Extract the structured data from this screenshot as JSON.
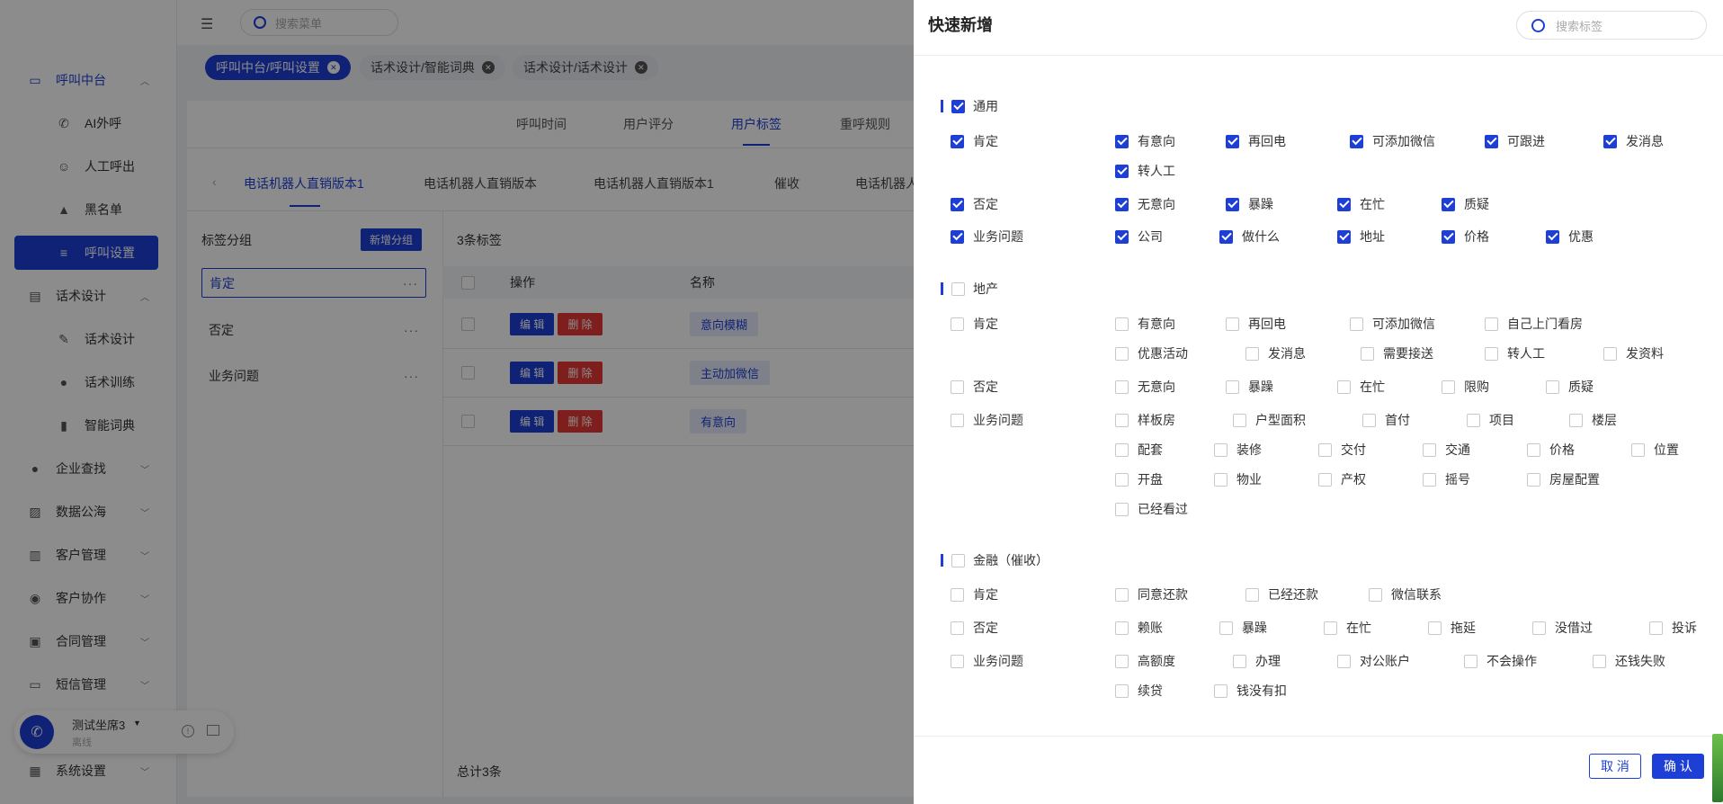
{
  "app": {
    "search_menu_placeholder": "搜索菜单",
    "sidebar": [
      {
        "label": "呼叫中台",
        "icon": "monitor-icon",
        "level": 0,
        "state": "parent-active",
        "arrow": "chevron-up-icon"
      },
      {
        "label": "AI外呼",
        "icon": "phone-icon",
        "level": 1
      },
      {
        "label": "人工呼出",
        "icon": "users-icon",
        "level": 1
      },
      {
        "label": "黑名单",
        "icon": "warning-icon",
        "level": 1
      },
      {
        "label": "呼叫设置",
        "icon": "sliders-icon",
        "level": 1,
        "state": "active"
      },
      {
        "label": "话术设计",
        "icon": "book-icon",
        "level": 0,
        "arrow": "chevron-up-icon"
      },
      {
        "label": "话术设计",
        "icon": "pen-icon",
        "level": 1
      },
      {
        "label": "话术训练",
        "icon": "chat-icon",
        "level": 1
      },
      {
        "label": "智能词典",
        "icon": "dictionary-icon",
        "level": 1
      },
      {
        "label": "企业查找",
        "icon": "bulb-icon",
        "level": 0,
        "arrow": "chevron-down-icon"
      },
      {
        "label": "数据公海",
        "icon": "chart-icon",
        "level": 0,
        "arrow": "chevron-down-icon"
      },
      {
        "label": "客户管理",
        "icon": "customer-icon",
        "level": 0,
        "arrow": "chevron-down-icon"
      },
      {
        "label": "客户协作",
        "icon": "collab-icon",
        "level": 0,
        "arrow": "chevron-down-icon"
      },
      {
        "label": "合同管理",
        "icon": "contract-icon",
        "level": 0,
        "arrow": "chevron-down-icon"
      },
      {
        "label": "短信管理",
        "icon": "sms-icon",
        "level": 0,
        "arrow": "chevron-down-icon"
      },
      {
        "label": "系统设置",
        "icon": "grid-icon",
        "level": 0,
        "arrow": "chevron-down-icon"
      }
    ],
    "agent": {
      "name": "测试坐席3",
      "status": "离线"
    },
    "open_tabs": [
      {
        "label": "呼叫中台/呼叫设置",
        "active": true
      },
      {
        "label": "话术设计/智能词典",
        "active": false
      },
      {
        "label": "话术设计/话术设计",
        "active": false
      }
    ],
    "sub_tabs": [
      "呼叫时间",
      "用户评分",
      "用户标签",
      "重呼规则"
    ],
    "sub_tab_active": 2,
    "robot_tabs": [
      "电话机器人直销版本1",
      "电话机器人直销版本",
      "电话机器人直销版本1",
      "催收",
      "电话机器人"
    ],
    "robot_tab_active": 0,
    "group_panel": {
      "title": "标签分组",
      "add_label": "新增分组",
      "items": [
        "肯定",
        "否定",
        "业务问题"
      ],
      "active": 0
    },
    "table": {
      "count_label": "3条标签",
      "headers": [
        "操作",
        "名称"
      ],
      "edit_label": "编 辑",
      "delete_label": "删 除",
      "rows": [
        "意向模糊",
        "主动加微信",
        "有意向"
      ],
      "total_label": "总计3条"
    }
  },
  "drawer": {
    "title": "快速新增",
    "search_placeholder": "搜索标签",
    "cancel_label": "取 消",
    "confirm_label": "确 认",
    "sections": [
      {
        "title": "通用",
        "checked": true,
        "groups": [
          {
            "name": "肯定",
            "checked": true,
            "rows": [
              [
                "有意向",
                "再回电",
                "可添加微信",
                "可跟进",
                "发消息"
              ],
              [
                "转人工"
              ]
            ],
            "checked_items": true
          },
          {
            "name": "否定",
            "checked": true,
            "rows": [
              [
                "无意向",
                "暴躁",
                "在忙",
                "质疑"
              ]
            ],
            "checked_items": true
          },
          {
            "name": "业务问题",
            "checked": true,
            "rows": [
              [
                "公司",
                "做什么",
                "地址",
                "价格",
                "优惠"
              ]
            ],
            "checked_items": true
          }
        ]
      },
      {
        "title": "地产",
        "checked": false,
        "groups": [
          {
            "name": "肯定",
            "checked": false,
            "rows": [
              [
                "有意向",
                "再回电",
                "可添加微信",
                "自己上门看房"
              ],
              [
                "优惠活动",
                "发消息",
                "需要接送",
                "转人工",
                "发资料"
              ]
            ],
            "checked_items": false
          },
          {
            "name": "否定",
            "checked": false,
            "rows": [
              [
                "无意向",
                "暴躁",
                "在忙",
                "限购",
                "质疑"
              ]
            ],
            "checked_items": false
          },
          {
            "name": "业务问题",
            "checked": false,
            "rows": [
              [
                "样板房",
                "户型面积",
                "首付",
                "项目",
                "楼层"
              ],
              [
                "配套",
                "装修",
                "交付",
                "交通",
                "价格",
                "位置"
              ],
              [
                "开盘",
                "物业",
                "产权",
                "摇号",
                "房屋配置"
              ],
              [
                "已经看过"
              ]
            ],
            "checked_items": false
          }
        ]
      },
      {
        "title": "金融（催收）",
        "checked": false,
        "groups": [
          {
            "name": "肯定",
            "checked": false,
            "rows": [
              [
                "同意还款",
                "已经还款",
                "微信联系"
              ]
            ],
            "checked_items": false
          },
          {
            "name": "否定",
            "checked": false,
            "rows": [
              [
                "赖账",
                "暴躁",
                "在忙",
                "拖延",
                "没借过",
                "投诉"
              ]
            ],
            "checked_items": false
          },
          {
            "name": "业务问题",
            "checked": false,
            "rows": [
              [
                "高额度",
                "办理",
                "对公账户",
                "不会操作",
                "还钱失败"
              ],
              [
                "续贷",
                "钱没有扣"
              ]
            ],
            "checked_items": false
          }
        ]
      }
    ]
  },
  "colors": {
    "accent": "#1e3fd6",
    "danger": "#e53935"
  }
}
